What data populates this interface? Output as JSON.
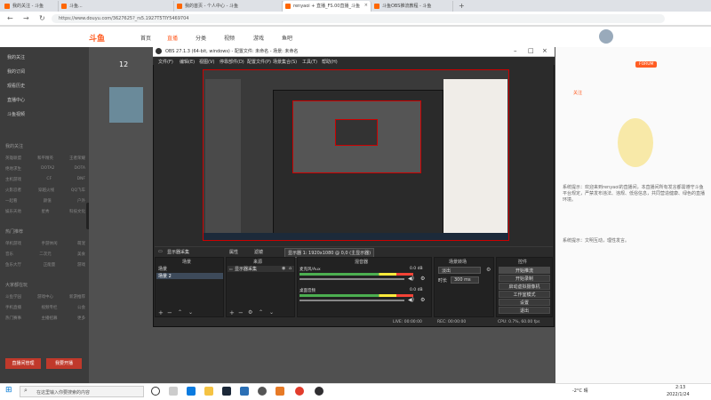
{
  "browser": {
    "tabs": [
      "我的关注 - 斗鱼",
      "斗鱼...",
      "我的首页 - 个人中心 - 斗鱼",
      "renyaoi + 直播_FS.00直播_斗鱼",
      "斗鱼OBS推流教程 - 斗鱼"
    ],
    "url": "https://www.douyu.com/3627625?_rs5.1927T5TIY5469704",
    "new_tab": "+"
  },
  "site": {
    "logo": "斗鱼",
    "nav": [
      "首页",
      "直播",
      "分类",
      "视频",
      "游戏",
      "鱼吧"
    ],
    "follow_count": "12",
    "sidebar": {
      "items": [
        "我的关注",
        "我的订阅",
        "观看历史",
        "直播中心",
        "斗鱼视频"
      ],
      "section1": "我的关注",
      "grid1": [
        [
          "英雄联盟",
          "和平精英",
          "王者荣耀"
        ],
        [
          "绝地求生",
          "DOTA2",
          "DOTA"
        ],
        [
          "主机游戏",
          "CF",
          "DNF"
        ],
        [
          "火影忍者",
          "穿越火线",
          "QQ飞车"
        ],
        [
          "一起看",
          "颜值",
          "户外"
        ],
        [
          "娱乐天地",
          "星秀",
          "科技文化"
        ]
      ],
      "section2": "热门推荐",
      "grid2": [
        [
          "单机游戏",
          "手游休闲",
          "萌宠"
        ],
        [
          "音乐",
          "二次元",
          "美食"
        ],
        [
          "鱼乐大厅",
          "正能量",
          "游戏"
        ]
      ],
      "section3": "大家都在玩",
      "grid3": [
        [
          "斗鱼学园",
          "游戏中心",
          "新游推荐"
        ],
        [
          "手机直播",
          "视频专栏",
          "公会"
        ],
        [
          "热门赛事",
          "主播招募",
          "更多"
        ]
      ],
      "bottom_buttons": [
        "直播间管理",
        "我要开播"
      ]
    },
    "right": {
      "badge": "FORUM",
      "label1": "关注",
      "chat1": "系统提示：欢迎来到renyaoi的直播间，本直播间所有发言都需遵守斗鱼平台规定，严禁发布违法、违规、低俗信息，共同营造健康、绿色的直播环境。",
      "chat2": "系统提示：文明互动，理性发言。"
    }
  },
  "obs": {
    "title": "OBS 27.1.3 (64-bit, windows) - 配置文件: 未命名 - 场景: 未命名",
    "menu": [
      "文件(F)",
      "编辑(E)",
      "视图(V)",
      "停靠部件(D)",
      "配置文件(P)",
      "场景集合(S)",
      "工具(T)",
      "帮助(H)"
    ],
    "toolbar_label": "显示器采集",
    "props": "属性",
    "filters": "滤镜",
    "display": "显示器 1: 1920x1080 @ 0,0 (主显示器)",
    "scenes_header": "场景",
    "scenes": [
      "场景",
      "场景 2"
    ],
    "sources_header": "来源",
    "sources": [
      "显示器采集"
    ],
    "mixer_header": "混音器",
    "mixer": [
      {
        "name": "桌面音频",
        "db": "0.0 dB"
      },
      {
        "name": "麦克风/Aux",
        "db": "0.0 dB"
      }
    ],
    "transition_header": "场景转场",
    "transition": "淡出",
    "duration_label": "时长",
    "duration": "300 ms",
    "controls_header": "控件",
    "controls": [
      "开始推流",
      "开始录制",
      "启动虚拟摄像机",
      "工作室模式",
      "设置",
      "退出"
    ],
    "status": {
      "live": "LIVE: 00:00:00",
      "rec": "REC: 00:00:00",
      "cpu": "CPU: 0.7%, 60.00 fps"
    }
  },
  "taskbar": {
    "search": "在这里输入你要搜索的内容",
    "weather": "-2°C 晴",
    "time": "2:13",
    "date": "2022/1/24"
  },
  "colors": {
    "douyu": "#ff5d23",
    "obs_bg": "#2b2b2b",
    "preview_border": "#cc0000"
  }
}
